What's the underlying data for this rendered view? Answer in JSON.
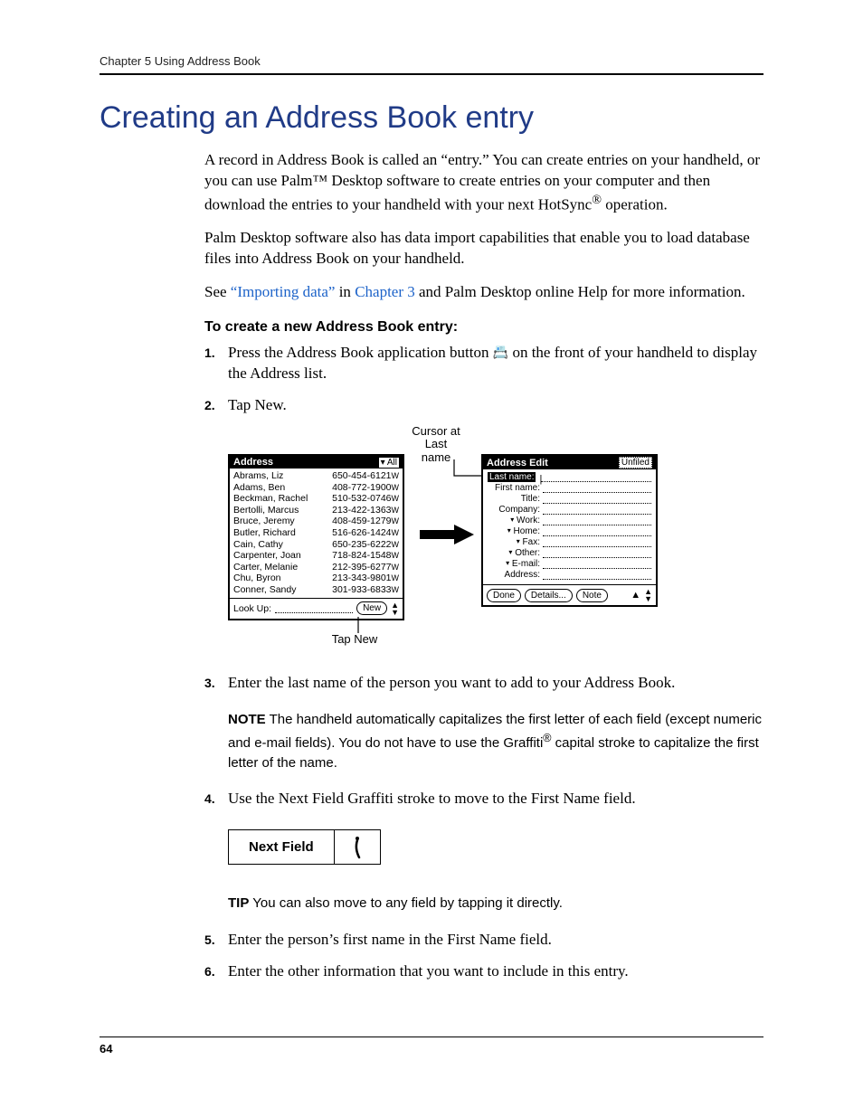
{
  "header": {
    "running": "Chapter 5   Using Address Book",
    "page_number": "64"
  },
  "title": "Creating an Address Book entry",
  "paragraphs": {
    "p1a": "A record in Address Book is called an “entry.” You can create entries on your handheld, or you can use Palm™ Desktop software to create entries on your computer and then download the entries to your handheld with your next HotSync",
    "p1b": " operation.",
    "p2": "Palm Desktop software also has data import capabilities that enable you to load database files into Address Book on your handheld.",
    "p3_pre": "See ",
    "p3_link1": "“Importing data”",
    "p3_mid": " in ",
    "p3_link2": "Chapter 3",
    "p3_post": " and Palm Desktop online Help for more information."
  },
  "subhead": "To create a new Address Book entry:",
  "steps": {
    "s1a": "Press the Address Book application button ",
    "s1b": " on the front of your handheld to display the Address list.",
    "s2": "Tap New.",
    "s3": "Enter the last name of the person you want to add to your Address Book.",
    "s4": "Use the Next Field Graffiti stroke to move to the First Name field.",
    "s5": "Enter the person’s first name in the First Name field.",
    "s6": "Enter the other information that you want to include in this entry."
  },
  "note": {
    "lead": "NOTE",
    "body_a": "  The handheld automatically capitalizes the first letter of each field (except numeric and e-mail fields). You do not have to use the Graffiti",
    "body_b": " capital stroke to capitalize the first letter of the name."
  },
  "tip": {
    "lead": "TIP",
    "body": "  You can also move to any field by tapping it directly."
  },
  "graffiti_label": "Next Field",
  "figure": {
    "callout_cursor": "Cursor at Last name",
    "callout_tapnew": "Tap New",
    "left": {
      "title": "Address",
      "category": "▾ All",
      "lookup": "Look Up:",
      "new_btn": "New",
      "rows": [
        {
          "name": "Abrams, Liz",
          "phone": "650-454-6121",
          "suf": "W"
        },
        {
          "name": "Adams, Ben",
          "phone": "408-772-1900",
          "suf": "W"
        },
        {
          "name": "Beckman, Rachel",
          "phone": "510-532-0746",
          "suf": "W"
        },
        {
          "name": "Bertolli, Marcus",
          "phone": "213-422-1363",
          "suf": "W"
        },
        {
          "name": "Bruce, Jeremy",
          "phone": "408-459-1279",
          "suf": "W"
        },
        {
          "name": "Butler, Richard",
          "phone": "516-626-1424",
          "suf": "W"
        },
        {
          "name": "Cain, Cathy",
          "phone": "650-235-6222",
          "suf": "W"
        },
        {
          "name": "Carpenter, Joan",
          "phone": "718-824-1548",
          "suf": "W"
        },
        {
          "name": "Carter, Melanie",
          "phone": "212-395-6277",
          "suf": "W"
        },
        {
          "name": "Chu, Byron",
          "phone": "213-343-9801",
          "suf": "W"
        },
        {
          "name": "Conner, Sandy",
          "phone": "301-933-6833",
          "suf": "W"
        }
      ]
    },
    "right": {
      "title": "Address Edit",
      "category": "Unfiled",
      "fields": [
        {
          "label": "Last name:",
          "selected": true,
          "dd": false
        },
        {
          "label": "First name:",
          "selected": false,
          "dd": false
        },
        {
          "label": "Title:",
          "selected": false,
          "dd": false
        },
        {
          "label": "Company:",
          "selected": false,
          "dd": false
        },
        {
          "label": "Work:",
          "selected": false,
          "dd": true
        },
        {
          "label": "Home:",
          "selected": false,
          "dd": true
        },
        {
          "label": "Fax:",
          "selected": false,
          "dd": true
        },
        {
          "label": "Other:",
          "selected": false,
          "dd": true
        },
        {
          "label": "E-mail:",
          "selected": false,
          "dd": true
        },
        {
          "label": "Address:",
          "selected": false,
          "dd": false
        }
      ],
      "buttons": {
        "done": "Done",
        "details": "Details...",
        "note": "Note"
      }
    }
  }
}
